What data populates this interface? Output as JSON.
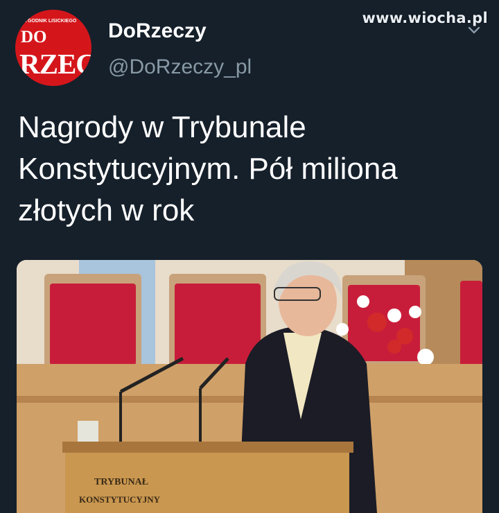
{
  "watermark": "www.wiocha.pl",
  "author": {
    "name": "DoRzeczy",
    "handle": "@DoRzeczy_pl",
    "avatar": {
      "masthead": "TYGODNIK LISICKIEGO",
      "line1": "DO",
      "line2": "RZEC",
      "color": "#d4161b"
    }
  },
  "tweet": {
    "text": "Nagrody w Trybunale Konstytucyjnym. Pół miliona złotych w rok"
  },
  "media": {
    "lectern_text_1": "TRYBUNAŁ",
    "lectern_text_2": "KONSTYTUCYJNY"
  },
  "icons": {
    "menu": "chevron-down-icon"
  },
  "colors": {
    "background": "#15202b",
    "text_primary": "#ffffff",
    "text_secondary": "#8899a6"
  }
}
